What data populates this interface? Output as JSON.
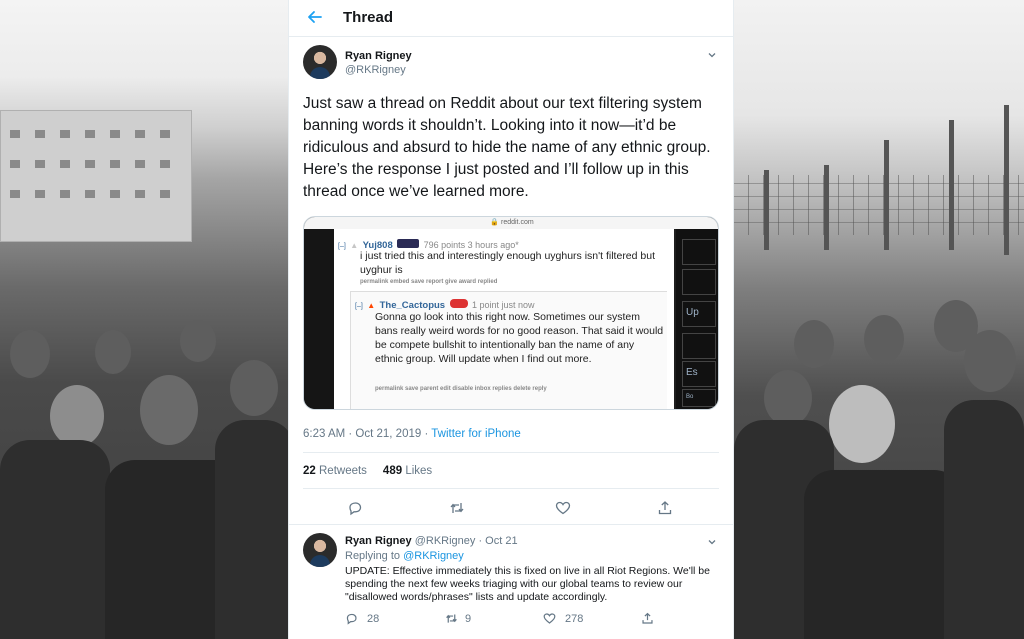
{
  "header": {
    "title": "Thread"
  },
  "main_tweet": {
    "author_name": "Ryan Rigney",
    "author_handle": "@RKRigney",
    "text": "Just saw a thread on Reddit about our text filtering system banning words it shouldn’t. Looking into it now—it’d be ridiculous and absurd to hide the name of any ethnic group. Here’s the response I just posted and I’ll follow up in this thread once we’ve learned more.",
    "timestamp": "6:23 AM · Oct 21, 2019",
    "separator": " · ",
    "source": "Twitter for iPhone",
    "retweets_count": "22",
    "retweets_label": "Retweets",
    "likes_count": "489",
    "likes_label": "Likes"
  },
  "embed": {
    "url": "reddit.com",
    "comment1": {
      "collapse": "[–]",
      "user": "Yuj808",
      "meta": "796 points 3 hours ago*",
      "body": "i just tried this and interestingly enough uyghurs isn't filtered but uyghur is",
      "links": "permalink  embed  save  report  give award  replied"
    },
    "comment2": {
      "collapse": "[–]",
      "user": "The_Cactopus",
      "meta": "1 point just now",
      "body": "Gonna go look into this right now. Sometimes our system bans really weird words for no good reason. That said it would be compete bullshit to intentionally ban the name of any ethnic group. Will update when I find out more.",
      "links": "permalink  save  parent  edit  disable inbox replies  delete  reply"
    },
    "sidebar": [
      "Up",
      "Es",
      "Bo"
    ]
  },
  "reply_tweet": {
    "author_name": "Ryan Rigney",
    "author_handle": "@RKRigney · Oct 21",
    "replying_prefix": "Replying to",
    "replying_to": "@RKRigney",
    "text": "UPDATE: Effective immediately this is fixed on live in all Riot Regions. We'll be spending the next few weeks triaging with our global teams to review our \"disallowed words/phrases\" lists and update accordingly.",
    "reply_count": "28",
    "retweet_count": "9",
    "like_count": "278"
  },
  "colors": {
    "accent": "#1da1f2",
    "text": "#14171a",
    "muted": "#657786",
    "reddit_link": "#336699"
  }
}
